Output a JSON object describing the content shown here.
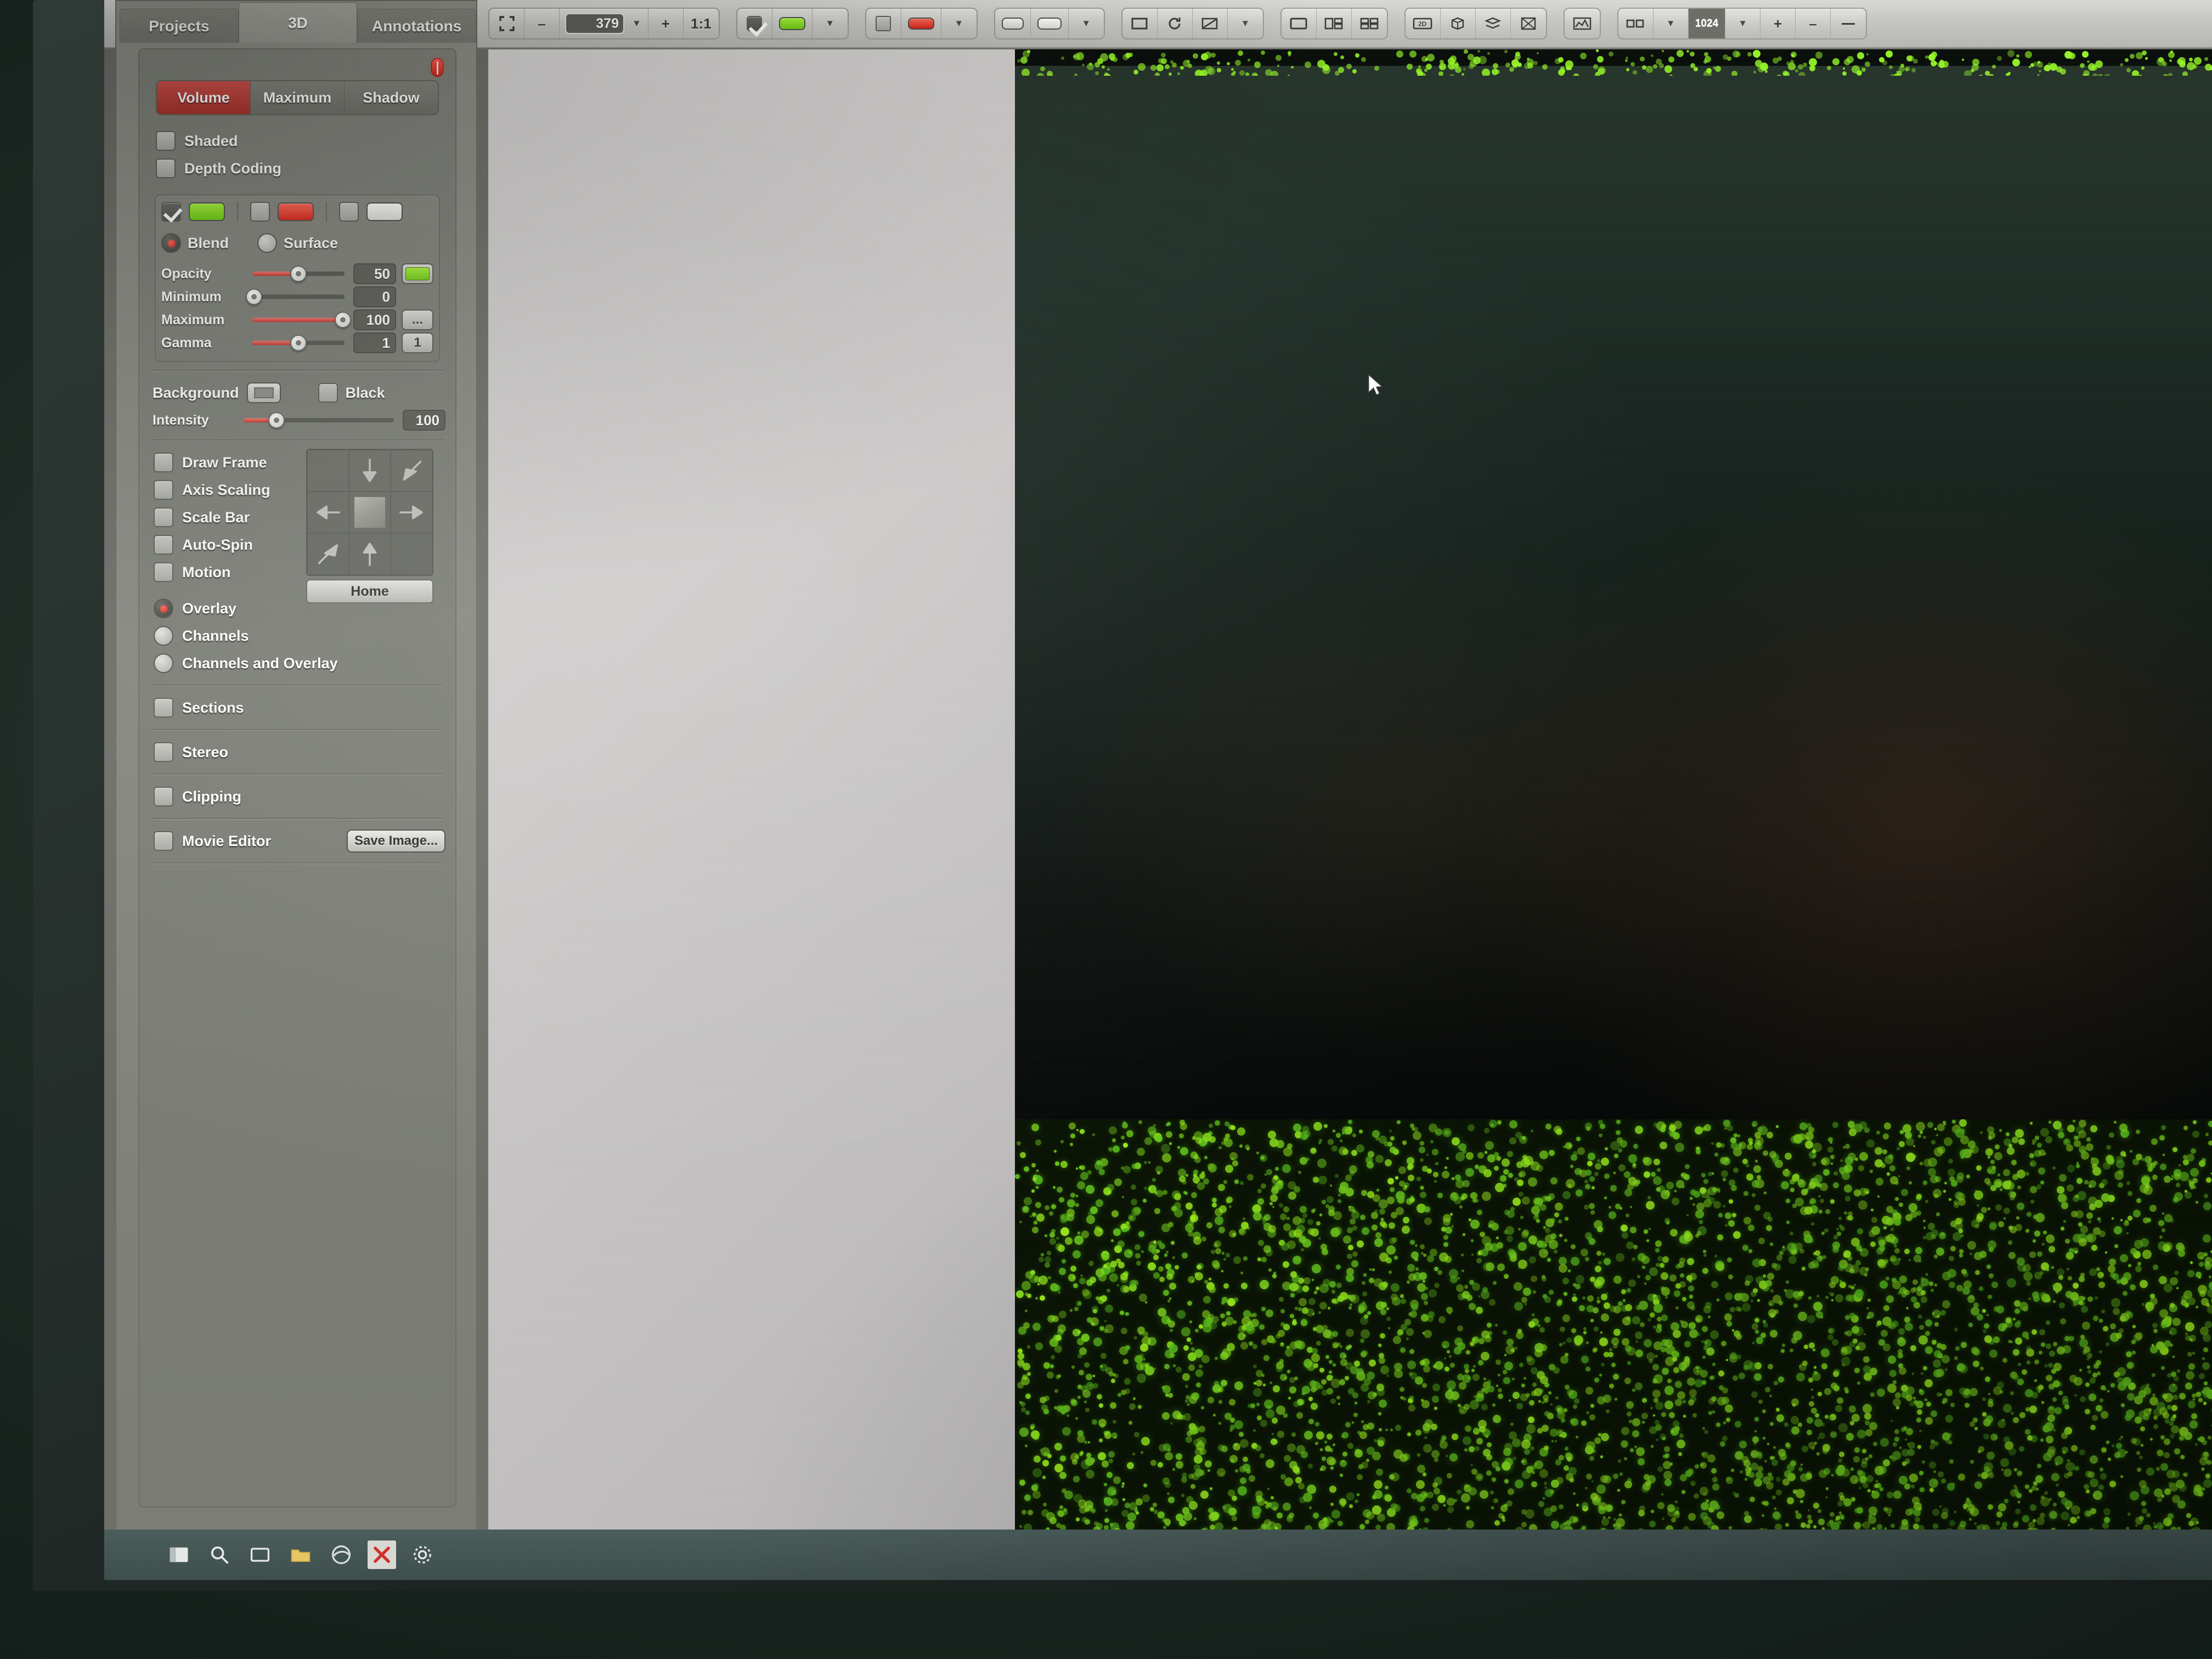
{
  "toolbar": {
    "fit_icon": "fit-to-window-icon",
    "zoom_out_label": "–",
    "zoom_value": "379",
    "zoom_caret": "▼",
    "zoom_in_label": "+",
    "one_to_one_label": "1:1",
    "groups": [
      {
        "name": "checkbox-green-group",
        "items": [
          "checkbox",
          "green-swatch",
          "caret"
        ]
      },
      {
        "name": "red-channel-group",
        "items": [
          "square",
          "red-swatch",
          "caret"
        ]
      },
      {
        "name": "white-channel-group",
        "items": [
          "rounded",
          "white-swatch",
          "caret"
        ]
      },
      {
        "name": "display-mode-group",
        "items": [
          "panel",
          "refresh",
          "contrast",
          "caret"
        ]
      },
      {
        "name": "layout-group",
        "items": [
          "single",
          "two-pane",
          "four-pane"
        ]
      },
      {
        "name": "view-mode-group",
        "items": [
          "2d",
          "3d",
          "slice",
          "section"
        ]
      },
      {
        "name": "chart-group",
        "items": [
          "histogram"
        ]
      },
      {
        "name": "slice-count-group",
        "items": [
          "pair",
          "value",
          "caret",
          "plus",
          "minus"
        ]
      }
    ],
    "spinner_value": "1024"
  },
  "left_panel": {
    "tabs": [
      {
        "label": "Projects",
        "active": false
      },
      {
        "label": "3D",
        "active": true
      },
      {
        "label": "Annotations",
        "active": false
      }
    ],
    "render_modes": [
      {
        "label": "Volume",
        "active": true
      },
      {
        "label": "Maximum",
        "active": false
      },
      {
        "label": "Shadow",
        "active": false
      }
    ],
    "render_options": [
      {
        "label": "Shaded",
        "checked": false
      },
      {
        "label": "Depth Coding",
        "checked": false
      }
    ],
    "channels": [
      {
        "name": "channel-1",
        "checked": true,
        "color": "#8cf02a"
      },
      {
        "name": "channel-2",
        "checked": false,
        "color": "#f52d1c"
      },
      {
        "name": "channel-3",
        "checked": false,
        "color": "#fdfdfb"
      }
    ],
    "blend_modes": [
      {
        "label": "Blend",
        "selected": true
      },
      {
        "label": "Surface",
        "selected": false
      }
    ],
    "sliders": [
      {
        "label": "Opacity",
        "value": "50",
        "percent": 50,
        "fill_from_left": true,
        "button": "color",
        "button_label": ""
      },
      {
        "label": "Minimum",
        "value": "0",
        "percent": 0,
        "fill_from_left": false,
        "button": "none",
        "button_label": ""
      },
      {
        "label": "Maximum",
        "value": "100",
        "percent": 100,
        "fill_from_left": true,
        "button": "dots",
        "button_label": "..."
      },
      {
        "label": "Gamma",
        "value": "1",
        "percent": 50,
        "fill_from_left": true,
        "button": "text",
        "button_label": "1"
      }
    ],
    "background": {
      "label": "Background",
      "swatch_name": "background-color-swatch",
      "black_label": "Black",
      "black_checked": false,
      "intensity_label": "Intensity",
      "intensity_value": "100",
      "intensity_percent": 30
    },
    "view_options": [
      {
        "label": "Draw Frame",
        "checked": false
      },
      {
        "label": "Axis Scaling",
        "checked": false
      },
      {
        "label": "Scale Bar",
        "checked": false
      },
      {
        "label": "Auto-Spin",
        "checked": false
      },
      {
        "label": "Motion",
        "checked": false
      }
    ],
    "overlay_modes": [
      {
        "label": "Overlay",
        "selected": true
      },
      {
        "label": "Channels",
        "selected": false
      },
      {
        "label": "Channels and Overlay",
        "selected": false
      }
    ],
    "nav_pad": {
      "home_label": "Home",
      "center_name": "orientation-cube"
    },
    "sections_group": [
      {
        "label": "Sections",
        "checked": false
      },
      {
        "label": "Stereo",
        "checked": false
      },
      {
        "label": "Clipping",
        "checked": false
      },
      {
        "label": "Movie Editor",
        "checked": false
      }
    ],
    "save_image_label": "Save Image..."
  },
  "viewport": {
    "name": "3d-render-viewport",
    "cursor_name": "mouse-pointer"
  },
  "taskbar": {
    "items": [
      {
        "name": "start-button-icon"
      },
      {
        "name": "search-icon"
      },
      {
        "name": "task-view-icon"
      },
      {
        "name": "file-explorer-icon"
      },
      {
        "name": "edge-browser-icon"
      },
      {
        "name": "imaris-app-icon"
      },
      {
        "name": "settings-gear-icon"
      }
    ]
  },
  "colors": {
    "accent_red": "#c93a31",
    "channel_green": "#8cf02a",
    "panel_gray": "#7f817a"
  }
}
